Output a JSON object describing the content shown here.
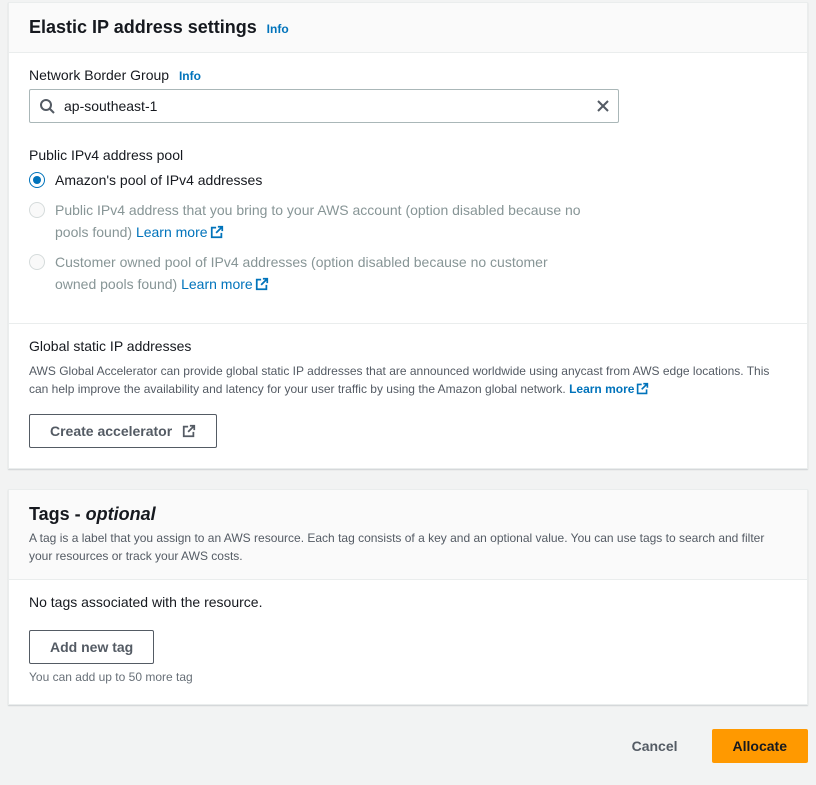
{
  "settings": {
    "title": "Elastic IP address settings",
    "info": "Info",
    "networkBorder": {
      "label": "Network Border Group",
      "info": "Info",
      "value": "ap-southeast-1"
    },
    "pool": {
      "label": "Public IPv4 address pool",
      "options": [
        {
          "label": "Amazon's pool of IPv4 addresses",
          "selected": true,
          "disabled": false
        },
        {
          "label": "Public IPv4 address that you bring to your AWS account (option disabled because no pools found) ",
          "selected": false,
          "disabled": true,
          "learn_more": "Learn more"
        },
        {
          "label": "Customer owned pool of IPv4 addresses (option disabled because no customer owned pools found) ",
          "selected": false,
          "disabled": true,
          "learn_more": "Learn more"
        }
      ]
    },
    "global_ip": {
      "heading": "Global static IP addresses",
      "description": "AWS Global Accelerator can provide global static IP addresses that are announced worldwide using anycast from AWS edge locations. This can help improve the availability and latency for your user traffic by using the Amazon global network. ",
      "learn_more": "Learn more",
      "button": "Create accelerator"
    }
  },
  "tags": {
    "title": "Tags - ",
    "optional": "optional",
    "description": "A tag is a label that you assign to an AWS resource. Each tag consists of a key and an optional value. You can use tags to search and filter your resources or track your AWS costs.",
    "empty": "No tags associated with the resource.",
    "add_button": "Add new tag",
    "limit": "You can add up to 50 more tag"
  },
  "footer": {
    "cancel": "Cancel",
    "allocate": "Allocate"
  }
}
